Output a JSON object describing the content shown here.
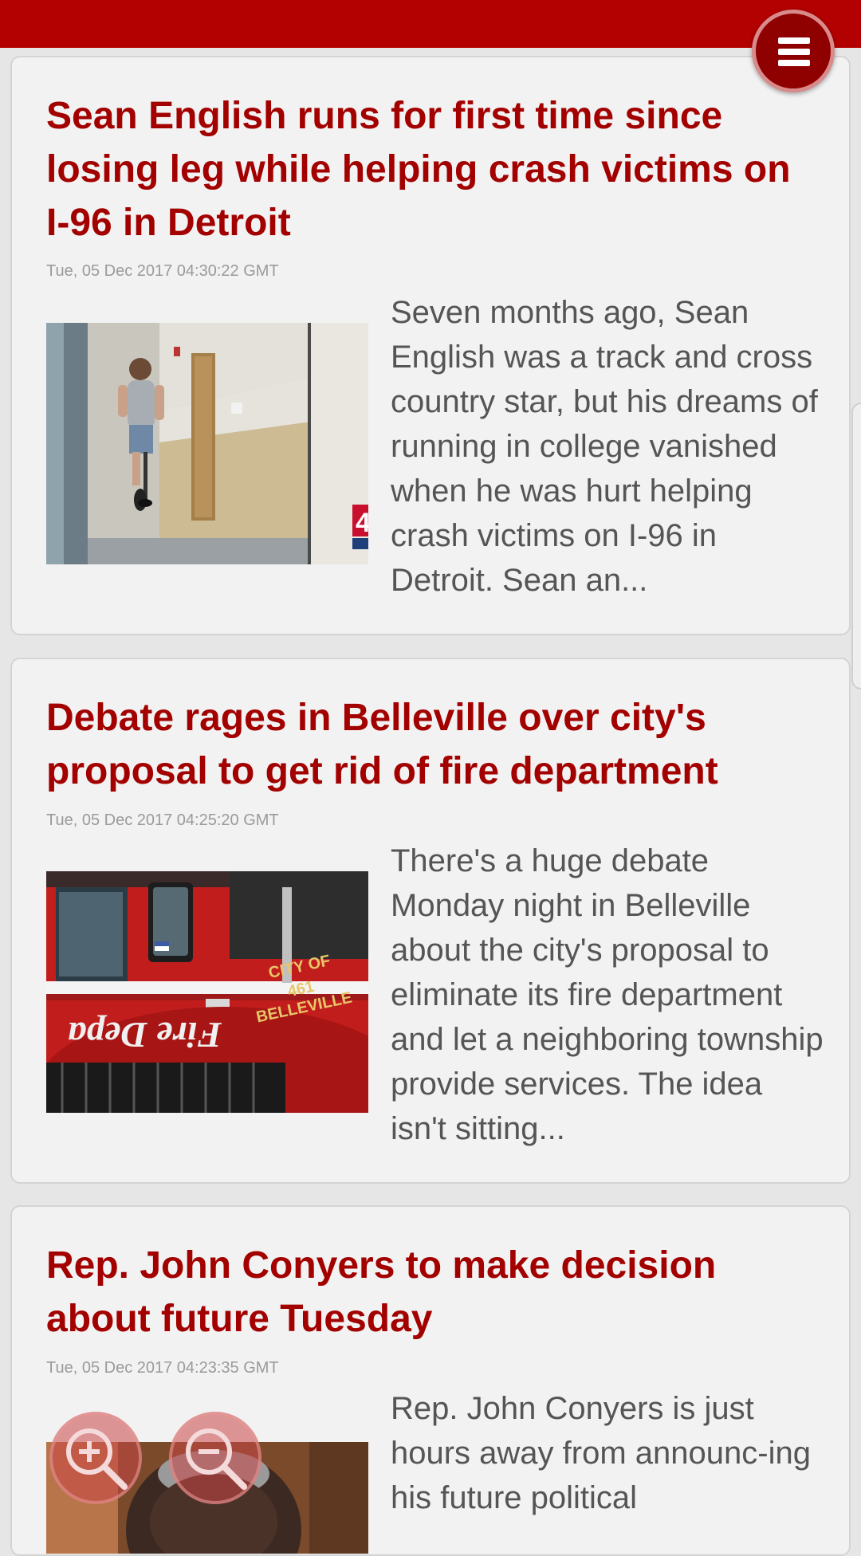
{
  "colors": {
    "brand": "#b30000",
    "headline": "#a30000",
    "summary_text": "#555555",
    "date_text": "#9a9a9a",
    "card_bg": "#f2f2f2"
  },
  "menu": {
    "icon": "hamburger-menu-icon"
  },
  "zoom": {
    "in_icon": "zoom-in-icon",
    "out_icon": "zoom-out-icon"
  },
  "articles": [
    {
      "title": "Sean English runs for first time since losing leg while helping crash victims on I-96 in Detroit",
      "date": "Tue, 05 Dec 2017 04:30:22 GMT",
      "summary": "Seven months ago, Sean English was a track and cross country star, but his dreams of running in college vanished when he was hurt helping crash victims on I-96 in Detroit.  Sean an...",
      "image": "runner-hallway-photo"
    },
    {
      "title": "Debate rages in Belleville over city's proposal to get rid of fire department",
      "date": "Tue, 05 Dec 2017 04:25:20 GMT",
      "summary": "There's a huge debate Monday night in Belleville about the city's proposal to eliminate its fire department and let a neighboring township provide services.  The idea isn't sitting...",
      "image": "fire-truck-photo",
      "truck_door_text": "CITY OF",
      "truck_door_number": "461",
      "truck_door_city": "BELLEVILLE",
      "truck_side_text": "Fire Depa"
    },
    {
      "title": "Rep. John Conyers to make decision about future Tuesday",
      "date": "Tue, 05 Dec 2017 04:23:35 GMT",
      "summary": "Rep. John Conyers is just hours away from announc-ing his future political",
      "image": "portrait-photo"
    }
  ]
}
